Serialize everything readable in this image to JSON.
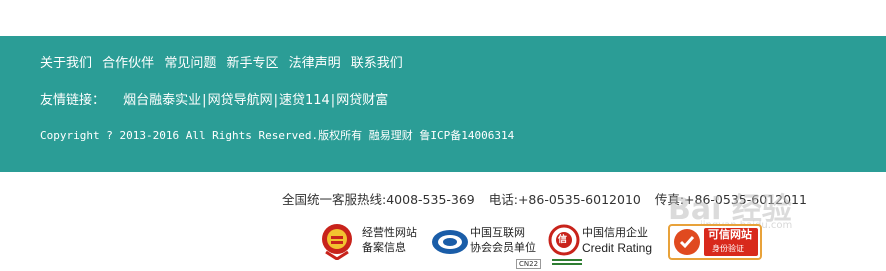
{
  "footer": {
    "nav": [
      "关于我们",
      "合作伙伴",
      "常见问题",
      "新手专区",
      "法律声明",
      "联系我们"
    ],
    "friend_label": "友情链接：",
    "friend_links": [
      "烟台融泰实业",
      "网贷导航网",
      "速贷114",
      "网贷财富"
    ],
    "friend_sep": "|",
    "copyright": "Copyright ? 2013-2016 All Rights Reserved.版权所有 融易理财 鲁ICP备14006314"
  },
  "contact": {
    "hotline": "全国统一客服热线:4008-535-369",
    "phone": "电话:+86-0535-6012010",
    "fax": "传真:+86-0535-6012011"
  },
  "badges": {
    "icp": {
      "line1": "经营性网站",
      "line2": "备案信息"
    },
    "internet": {
      "line1": "中国互联网",
      "line2": "协会会员单位"
    },
    "credit": {
      "line1": "中国信用企业",
      "line2": "Credit Rating",
      "seal": "信"
    },
    "trusted": {
      "line1": "可信网站",
      "line2": "身份验证"
    },
    "small_tag": "CN22"
  },
  "watermark": {
    "main": "Bai 经验",
    "sub": "jingyan.baidu.com"
  },
  "colors": {
    "teal": "#2b9d96",
    "seal_red": "#c8231b",
    "blue": "#1a5da8"
  }
}
